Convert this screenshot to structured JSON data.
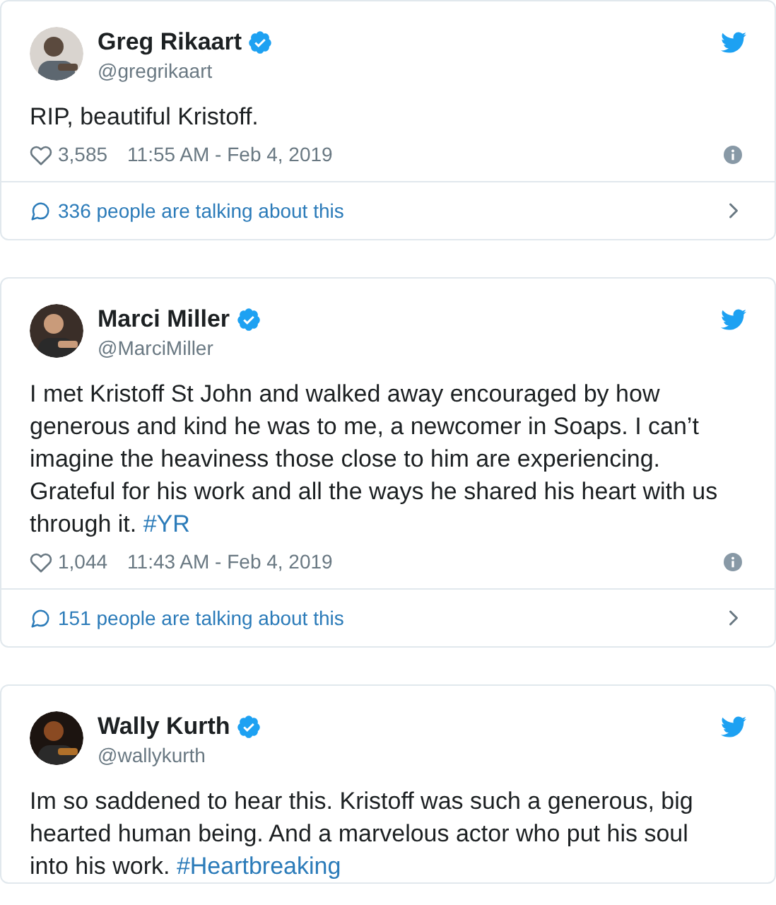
{
  "tweets": [
    {
      "name": "Greg Rikaart",
      "verified": true,
      "handle": "@gregrikaart",
      "text": "RIP, beautiful Kristoff.",
      "likes": "3,585",
      "time": "11:55 AM - Feb 4, 2019",
      "talking": "336 people are talking about this"
    },
    {
      "name": "Marci Miller",
      "verified": true,
      "handle": "@MarciMiller",
      "text": "I met Kristoff St John and walked away encouraged by how generous and kind he was to me, a newcomer in Soaps. I can’t imagine the heaviness those close to him are experiencing. Grateful for his work and all the ways he shared his heart with us through it. ",
      "hashtag": "#YR",
      "likes": "1,044",
      "time": "11:43 AM - Feb 4, 2019",
      "talking": "151 people are talking about this"
    },
    {
      "name": "Wally Kurth",
      "verified": true,
      "handle": "@wallykurth",
      "text": "Im so saddened to hear this. Kristoff was such a generous, big hearted human being. And a marvelous actor who put his soul into his work. ",
      "hashtag": "#Heartbreaking"
    }
  ]
}
